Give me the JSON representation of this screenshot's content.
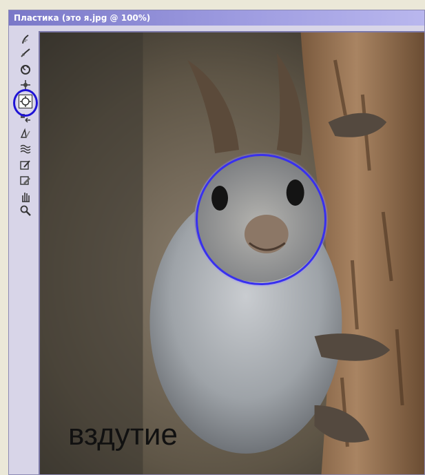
{
  "window": {
    "title": "Пластика (это я.jpg @  100%)"
  },
  "toolbar": {
    "tools": [
      {
        "name": "forward-warp-tool-icon",
        "active": false
      },
      {
        "name": "reconstruct-tool-icon",
        "active": false
      },
      {
        "name": "twirl-tool-icon",
        "active": false
      },
      {
        "name": "pucker-tool-icon",
        "active": false
      },
      {
        "name": "bloat-tool-icon",
        "active": true
      },
      {
        "name": "push-left-tool-icon",
        "active": false
      },
      {
        "name": "mirror-tool-icon",
        "active": false
      },
      {
        "name": "turbulence-tool-icon",
        "active": false
      },
      {
        "name": "freeze-mask-tool-icon",
        "active": false
      },
      {
        "name": "thaw-mask-tool-icon",
        "active": false
      },
      {
        "name": "hand-tool-icon",
        "active": false
      },
      {
        "name": "zoom-tool-icon",
        "active": false
      }
    ]
  },
  "canvas": {
    "caption": "вздутие"
  },
  "colors": {
    "annotation": "#1f14d6",
    "brush_outline": "#3830ee",
    "title_bar": "#8a88d4"
  }
}
